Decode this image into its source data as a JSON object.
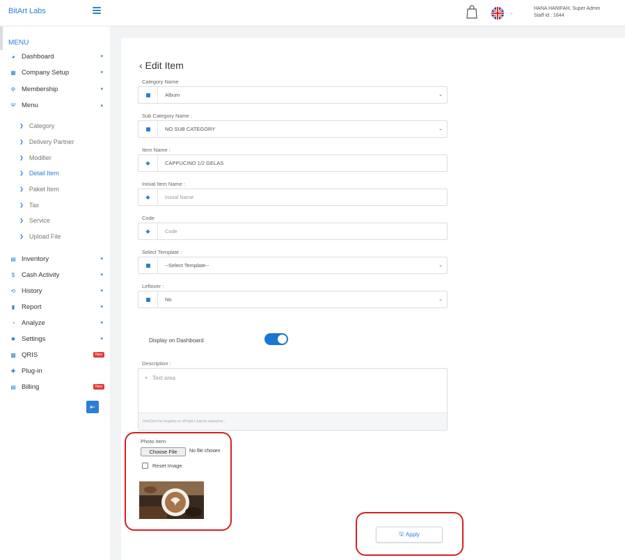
{
  "brand": "BitArt Labs",
  "user": {
    "name": "HANA HANIFAH, Super Admin",
    "staff_id": "Staff Id : 1644",
    "caret": "⌄"
  },
  "sidebar": {
    "menu_title": "MENU",
    "items": [
      {
        "label": "Dashboard",
        "icon": "dashboard-icon",
        "glyph": "◕",
        "caret": "▾"
      },
      {
        "label": "Company Setup",
        "icon": "building-icon",
        "glyph": "▦",
        "caret": "▾"
      },
      {
        "label": "Membership",
        "icon": "members-icon",
        "glyph": "✣",
        "caret": "▾"
      },
      {
        "label": "Menu",
        "icon": "cutlery-icon",
        "glyph": "Ψ",
        "caret": "▴"
      }
    ],
    "sub_items": [
      {
        "label": "Category",
        "arrow": "❯"
      },
      {
        "label": "Delivery Partner",
        "arrow": "❯"
      },
      {
        "label": "Modifier",
        "arrow": "❯"
      },
      {
        "label": "Detail Item",
        "arrow": "❯"
      },
      {
        "label": "Paket Item",
        "arrow": "❯"
      },
      {
        "label": "Tax",
        "arrow": "❯"
      },
      {
        "label": "Service",
        "arrow": "❯"
      },
      {
        "label": "Upload File",
        "arrow": "❯"
      }
    ],
    "items_lower": [
      {
        "label": "Inventory",
        "icon": "box-icon",
        "glyph": "▤",
        "caret": "▾"
      },
      {
        "label": "Cash Activity",
        "icon": "dollar-icon",
        "glyph": "$",
        "caret": "▾"
      },
      {
        "label": "History",
        "icon": "history-icon",
        "glyph": "⟲",
        "caret": "▾"
      },
      {
        "label": "Report",
        "icon": "report-icon",
        "glyph": "▮",
        "caret": "▾"
      },
      {
        "label": "Analyze",
        "icon": "analyze-icon",
        "glyph": "◔",
        "caret": "▾"
      },
      {
        "label": "Settings",
        "icon": "gear-icon",
        "glyph": "✹",
        "caret": "▾"
      },
      {
        "label": "QRIS",
        "icon": "qr-icon",
        "glyph": "▩",
        "badge": "New"
      },
      {
        "label": "Plug-in",
        "icon": "plugin-icon",
        "glyph": "✚"
      },
      {
        "label": "Billing",
        "icon": "billing-icon",
        "glyph": "▤",
        "badge": "New"
      }
    ],
    "collapse_glyph": "⇤"
  },
  "form": {
    "title": "‹ Edit Item",
    "fields": [
      {
        "label": "Category Name",
        "value": "Album",
        "placeholder": false,
        "select": true,
        "icon": "square"
      },
      {
        "label": "Sub Category Name :",
        "value": "NO SUB CATEGORY",
        "placeholder": false,
        "select": true,
        "icon": "square"
      },
      {
        "label": "Item Name :",
        "value": "CAPPUCINO 1/2 GELAS",
        "placeholder": false,
        "select": false,
        "icon": "tag"
      },
      {
        "label": "Inisial Item Name :",
        "value": "Inisial Name",
        "placeholder": true,
        "select": false,
        "icon": "tag"
      },
      {
        "label": "Code",
        "value": "Code",
        "placeholder": true,
        "select": false,
        "icon": "tag"
      },
      {
        "label": "Select Template :",
        "value": "--Select Template--",
        "placeholder": false,
        "select": true,
        "icon": "square"
      },
      {
        "label": "Leftover :",
        "value": "No",
        "placeholder": false,
        "select": true,
        "icon": "square"
      }
    ],
    "select_caret": "⌄",
    "tag_glyph": "◆",
    "display_on_dashboard": {
      "label": "Display on Dashboard",
      "on": true
    },
    "description": {
      "label": "Description :",
      "placeholder": "Text area",
      "hint": "Hint:Don't be negative or off topic! Just be awesome..."
    },
    "photo": {
      "label": "Photo Item",
      "choose_file": "Choose File",
      "file_status": "No file chosen",
      "reset_label": "Reset Image"
    },
    "apply_label": "Apply",
    "apply_glyph": "🖫"
  },
  "colors": {
    "accent": "#2b7fd3",
    "highlight": "#d61f1f",
    "toggle_on": "#1976d2"
  }
}
